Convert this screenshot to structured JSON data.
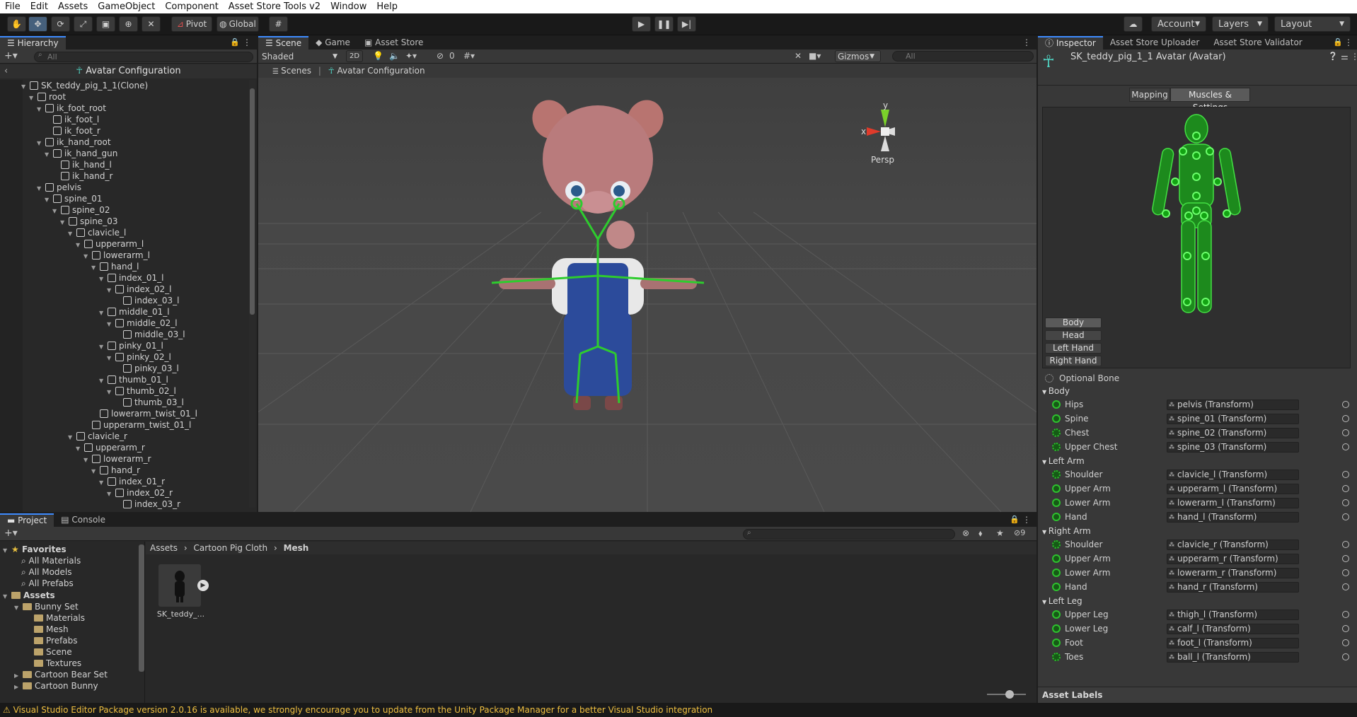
{
  "menubar": [
    "File",
    "Edit",
    "Assets",
    "GameObject",
    "Component",
    "Asset Store Tools v2",
    "Window",
    "Help"
  ],
  "toolbar": {
    "pivot": "Pivot",
    "global": "Global",
    "account": "Account",
    "layers": "Layers",
    "layout": "Layout"
  },
  "hierarchy": {
    "tab": "Hierarchy",
    "search_placeholder": "All",
    "header": "Avatar Configuration",
    "items": [
      {
        "label": "SK_teddy_pig_1_1(Clone)",
        "depth": 0,
        "expanded": true
      },
      {
        "label": "root",
        "depth": 1,
        "expanded": true
      },
      {
        "label": "ik_foot_root",
        "depth": 2,
        "expanded": true
      },
      {
        "label": "ik_foot_l",
        "depth": 3,
        "expanded": false
      },
      {
        "label": "ik_foot_r",
        "depth": 3,
        "expanded": false
      },
      {
        "label": "ik_hand_root",
        "depth": 2,
        "expanded": true
      },
      {
        "label": "ik_hand_gun",
        "depth": 3,
        "expanded": true
      },
      {
        "label": "ik_hand_l",
        "depth": 4,
        "expanded": false
      },
      {
        "label": "ik_hand_r",
        "depth": 4,
        "expanded": false
      },
      {
        "label": "pelvis",
        "depth": 2,
        "expanded": true
      },
      {
        "label": "spine_01",
        "depth": 3,
        "expanded": true
      },
      {
        "label": "spine_02",
        "depth": 4,
        "expanded": true
      },
      {
        "label": "spine_03",
        "depth": 5,
        "expanded": true
      },
      {
        "label": "clavicle_l",
        "depth": 6,
        "expanded": true
      },
      {
        "label": "upperarm_l",
        "depth": 7,
        "expanded": true
      },
      {
        "label": "lowerarm_l",
        "depth": 8,
        "expanded": true
      },
      {
        "label": "hand_l",
        "depth": 9,
        "expanded": true
      },
      {
        "label": "index_01_l",
        "depth": 10,
        "expanded": true
      },
      {
        "label": "index_02_l",
        "depth": 11,
        "expanded": true
      },
      {
        "label": "index_03_l",
        "depth": 12,
        "expanded": false
      },
      {
        "label": "middle_01_l",
        "depth": 10,
        "expanded": true
      },
      {
        "label": "middle_02_l",
        "depth": 11,
        "expanded": true
      },
      {
        "label": "middle_03_l",
        "depth": 12,
        "expanded": false
      },
      {
        "label": "pinky_01_l",
        "depth": 10,
        "expanded": true
      },
      {
        "label": "pinky_02_l",
        "depth": 11,
        "expanded": true
      },
      {
        "label": "pinky_03_l",
        "depth": 12,
        "expanded": false
      },
      {
        "label": "thumb_01_l",
        "depth": 10,
        "expanded": true
      },
      {
        "label": "thumb_02_l",
        "depth": 11,
        "expanded": true
      },
      {
        "label": "thumb_03_l",
        "depth": 12,
        "expanded": false
      },
      {
        "label": "lowerarm_twist_01_l",
        "depth": 9,
        "expanded": false
      },
      {
        "label": "upperarm_twist_01_l",
        "depth": 8,
        "expanded": false
      },
      {
        "label": "clavicle_r",
        "depth": 6,
        "expanded": true
      },
      {
        "label": "upperarm_r",
        "depth": 7,
        "expanded": true
      },
      {
        "label": "lowerarm_r",
        "depth": 8,
        "expanded": true
      },
      {
        "label": "hand_r",
        "depth": 9,
        "expanded": true
      },
      {
        "label": "index_01_r",
        "depth": 10,
        "expanded": true
      },
      {
        "label": "index_02_r",
        "depth": 11,
        "expanded": true
      },
      {
        "label": "index_03_r",
        "depth": 12,
        "expanded": false
      }
    ]
  },
  "scene": {
    "tabs": [
      "Scene",
      "Game",
      "Asset Store"
    ],
    "shading": "Shaded",
    "mode_2d": "2D",
    "hidden_count": "0",
    "gizmos": "Gizmos",
    "search_placeholder": "All",
    "breadcrumb_scenes": "Scenes",
    "breadcrumb_current": "Avatar Configuration",
    "axis_x": "x",
    "axis_y": "y",
    "projection": "Persp"
  },
  "inspector": {
    "tabs": [
      "Inspector",
      "Asset Store Uploader",
      "Asset Store Validator"
    ],
    "title": "SK_teddy_pig_1_1 Avatar (Avatar)",
    "mapping_tab": "Mapping",
    "muscles_tab": "Muscles & Settings",
    "body_buttons": [
      "Body",
      "Head",
      "Left Hand",
      "Right Hand"
    ],
    "optional_bone": "Optional Bone",
    "sections": [
      {
        "title": "Body",
        "bones": [
          {
            "name": "Hips",
            "value": "pelvis (Transform)",
            "optional": false
          },
          {
            "name": "Spine",
            "value": "spine_01 (Transform)",
            "optional": false
          },
          {
            "name": "Chest",
            "value": "spine_02 (Transform)",
            "optional": true
          },
          {
            "name": "Upper Chest",
            "value": "spine_03 (Transform)",
            "optional": true
          }
        ]
      },
      {
        "title": "Left Arm",
        "bones": [
          {
            "name": "Shoulder",
            "value": "clavicle_l (Transform)",
            "optional": true
          },
          {
            "name": "Upper Arm",
            "value": "upperarm_l (Transform)",
            "optional": false
          },
          {
            "name": "Lower Arm",
            "value": "lowerarm_l (Transform)",
            "optional": false
          },
          {
            "name": "Hand",
            "value": "hand_l (Transform)",
            "optional": false
          }
        ]
      },
      {
        "title": "Right Arm",
        "bones": [
          {
            "name": "Shoulder",
            "value": "clavicle_r (Transform)",
            "optional": true
          },
          {
            "name": "Upper Arm",
            "value": "upperarm_r (Transform)",
            "optional": false
          },
          {
            "name": "Lower Arm",
            "value": "lowerarm_r (Transform)",
            "optional": false
          },
          {
            "name": "Hand",
            "value": "hand_r (Transform)",
            "optional": false
          }
        ]
      },
      {
        "title": "Left Leg",
        "bones": [
          {
            "name": "Upper Leg",
            "value": "thigh_l (Transform)",
            "optional": false
          },
          {
            "name": "Lower Leg",
            "value": "calf_l (Transform)",
            "optional": false
          },
          {
            "name": "Foot",
            "value": "foot_l (Transform)",
            "optional": false
          },
          {
            "name": "Toes",
            "value": "ball_l (Transform)",
            "optional": true
          }
        ]
      }
    ],
    "asset_labels": "Asset Labels"
  },
  "project": {
    "tabs": [
      "Project",
      "Console"
    ],
    "hidden_count": "9",
    "favorites_title": "Favorites",
    "favorites": [
      "All Materials",
      "All Models",
      "All Prefabs"
    ],
    "assets_title": "Assets",
    "tree": [
      {
        "label": "Bunny Set",
        "depth": 1,
        "expanded": true
      },
      {
        "label": "Materials",
        "depth": 2,
        "expanded": false
      },
      {
        "label": "Mesh",
        "depth": 2,
        "expanded": false
      },
      {
        "label": "Prefabs",
        "depth": 2,
        "expanded": false
      },
      {
        "label": "Scene",
        "depth": 2,
        "expanded": false
      },
      {
        "label": "Textures",
        "depth": 2,
        "expanded": false
      },
      {
        "label": "Cartoon Bear Set",
        "depth": 1,
        "expanded": false
      },
      {
        "label": "Cartoon Bunny",
        "depth": 1,
        "expanded": false
      }
    ],
    "breadcrumb": [
      "Assets",
      "Cartoon Pig Cloth",
      "Mesh"
    ],
    "asset_name": "SK_teddy_..."
  },
  "status": {
    "message": "Visual Studio Editor Package version 2.0.16 is available, we strongly encourage you to update from the Unity Package Manager for a better Visual Studio integration"
  },
  "colors": {
    "accent": "#3d8bff",
    "bone_green": "#2ec22e",
    "warning": "#f0c040"
  }
}
